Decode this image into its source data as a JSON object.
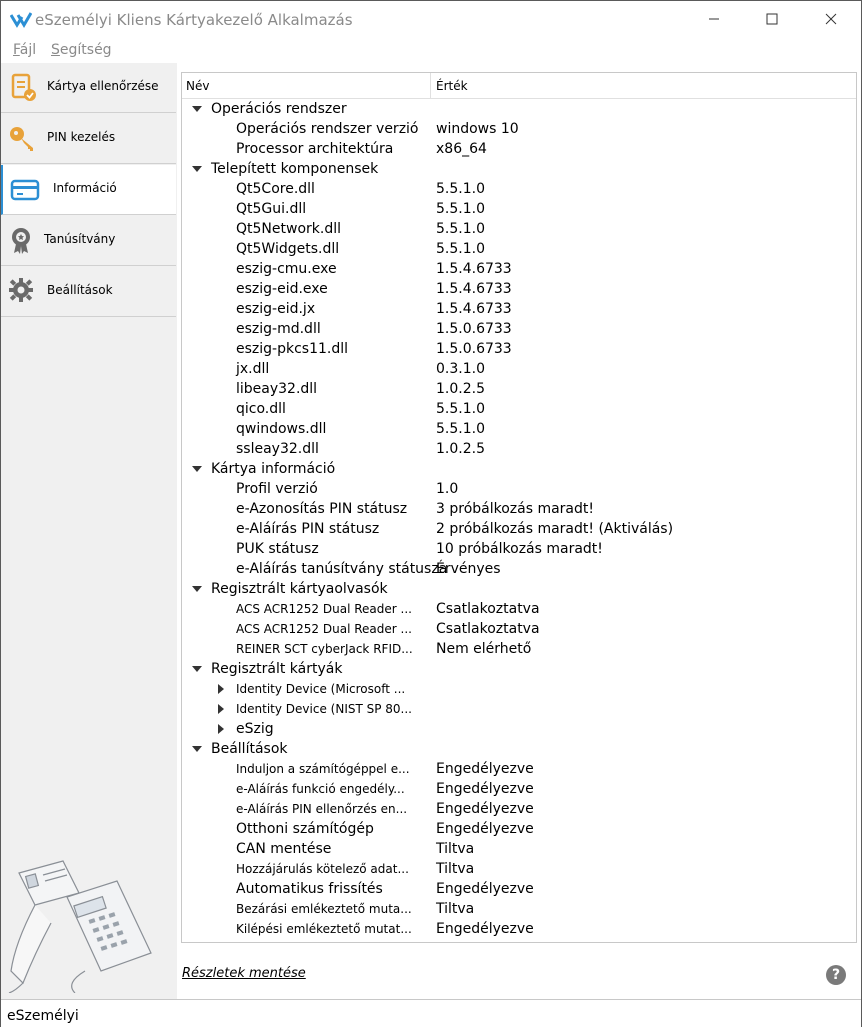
{
  "window": {
    "title": "eSzemélyi Kliens Kártyakezelő Alkalmazás",
    "accent_color": "#2c8fd4"
  },
  "menu": {
    "file": "Fájl",
    "help": "Segítség"
  },
  "nav": {
    "items": [
      {
        "label": "Kártya ellenőrzése",
        "icon": "card-check-icon"
      },
      {
        "label": "PIN kezelés",
        "icon": "key-icon"
      },
      {
        "label": "Információ",
        "icon": "info-card-icon"
      },
      {
        "label": "Tanúsítvány",
        "icon": "certificate-icon"
      },
      {
        "label": "Beállítások",
        "icon": "gear-icon"
      }
    ],
    "active_index": 2
  },
  "tree": {
    "headers": {
      "name": "Név",
      "value": "Érték"
    },
    "rows": [
      {
        "type": "group",
        "name": "Operációs rendszer",
        "value": ""
      },
      {
        "type": "child",
        "name": "Operációs rendszer verzió",
        "value": "windows 10"
      },
      {
        "type": "child",
        "name": "Processor architektúra",
        "value": "x86_64"
      },
      {
        "type": "group",
        "name": "Telepített komponensek",
        "value": ""
      },
      {
        "type": "child",
        "name": "Qt5Core.dll",
        "value": "5.5.1.0"
      },
      {
        "type": "child",
        "name": "Qt5Gui.dll",
        "value": "5.5.1.0"
      },
      {
        "type": "child",
        "name": "Qt5Network.dll",
        "value": "5.5.1.0"
      },
      {
        "type": "child",
        "name": "Qt5Widgets.dll",
        "value": "5.5.1.0"
      },
      {
        "type": "child",
        "name": "eszig-cmu.exe",
        "value": "1.5.4.6733"
      },
      {
        "type": "child",
        "name": "eszig-eid.exe",
        "value": "1.5.4.6733"
      },
      {
        "type": "child",
        "name": "eszig-eid.jx",
        "value": "1.5.4.6733"
      },
      {
        "type": "child",
        "name": "eszig-md.dll",
        "value": "1.5.0.6733"
      },
      {
        "type": "child",
        "name": "eszig-pkcs11.dll",
        "value": "1.5.0.6733"
      },
      {
        "type": "child",
        "name": "jx.dll",
        "value": "0.3.1.0"
      },
      {
        "type": "child",
        "name": "libeay32.dll",
        "value": "1.0.2.5"
      },
      {
        "type": "child",
        "name": "qico.dll",
        "value": "5.5.1.0"
      },
      {
        "type": "child",
        "name": "qwindows.dll",
        "value": "5.5.1.0"
      },
      {
        "type": "child",
        "name": "ssleay32.dll",
        "value": "1.0.2.5"
      },
      {
        "type": "group",
        "name": "Kártya információ",
        "value": ""
      },
      {
        "type": "child",
        "name": "Profil verzió",
        "value": "1.0"
      },
      {
        "type": "child",
        "name": "e-Azonosítás PIN státusz",
        "value": "3 próbálkozás maradt!"
      },
      {
        "type": "child",
        "name": "e-Aláírás PIN státusz",
        "value": "2 próbálkozás maradt! (Aktiválás)"
      },
      {
        "type": "child",
        "name": "PUK státusz",
        "value": "10 próbálkozás maradt!"
      },
      {
        "type": "child",
        "name": "e-Aláírás tanúsítvány státusza",
        "value": "Érvényes"
      },
      {
        "type": "group",
        "name": "Regisztrált kártyaolvasók",
        "value": ""
      },
      {
        "type": "child",
        "small": true,
        "name": "ACS ACR1252 Dual Reader ...",
        "value": "Csatlakoztatva"
      },
      {
        "type": "child",
        "small": true,
        "name": "ACS ACR1252 Dual Reader ...",
        "value": "Csatlakoztatva"
      },
      {
        "type": "child",
        "small": true,
        "name": "REINER SCT cyberJack RFID...",
        "value": "Nem elérhető"
      },
      {
        "type": "group",
        "name": "Regisztrált kártyák",
        "value": ""
      },
      {
        "type": "collapsed",
        "small": true,
        "name": "Identity Device (Microsoft ...",
        "value": ""
      },
      {
        "type": "collapsed",
        "small": true,
        "name": "Identity Device (NIST SP 80...",
        "value": ""
      },
      {
        "type": "collapsed",
        "name": "eSzig",
        "value": ""
      },
      {
        "type": "group",
        "name": "Beállítások",
        "value": ""
      },
      {
        "type": "child",
        "small": true,
        "name": "Induljon a számítógéppel e...",
        "value": "Engedélyezve"
      },
      {
        "type": "child",
        "small": true,
        "name": "e-Aláírás funkció engedély...",
        "value": "Engedélyezve"
      },
      {
        "type": "child",
        "small": true,
        "name": "e-Aláírás PIN ellenőrzés en...",
        "value": "Engedélyezve"
      },
      {
        "type": "child",
        "name": "Otthoni számítógép",
        "value": "Engedélyezve"
      },
      {
        "type": "child",
        "name": "CAN mentése",
        "value": "Tiltva"
      },
      {
        "type": "child",
        "small": true,
        "name": "Hozzájárulás kötelező adat...",
        "value": "Tiltva"
      },
      {
        "type": "child",
        "name": "Automatikus frissítés",
        "value": "Engedélyezve"
      },
      {
        "type": "child",
        "small": true,
        "name": "Bezárási emlékeztető muta...",
        "value": "Tiltva"
      },
      {
        "type": "child",
        "small": true,
        "name": "Kilépési emlékeztető mutat...",
        "value": "Engedélyezve"
      }
    ]
  },
  "footer": {
    "save_details": "Részletek mentése",
    "help_glyph": "?"
  },
  "status": {
    "text": "eSzemélyi"
  }
}
